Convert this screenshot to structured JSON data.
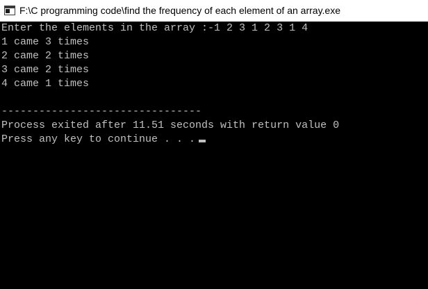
{
  "window": {
    "title": "F:\\C programming code\\find the frequency of each element of an array.exe",
    "icon": "console-app-icon"
  },
  "console": {
    "lines": [
      "Enter the elements in the array :-1 2 3 1 2 3 1 4",
      "1 came 3 times",
      "2 came 2 times",
      "3 came 2 times",
      "4 came 1 times",
      "",
      "--------------------------------",
      "Process exited after 11.51 seconds with return value 0",
      "Press any key to continue . . ."
    ],
    "text_color": "#c0c0c0",
    "background_color": "#000000"
  }
}
